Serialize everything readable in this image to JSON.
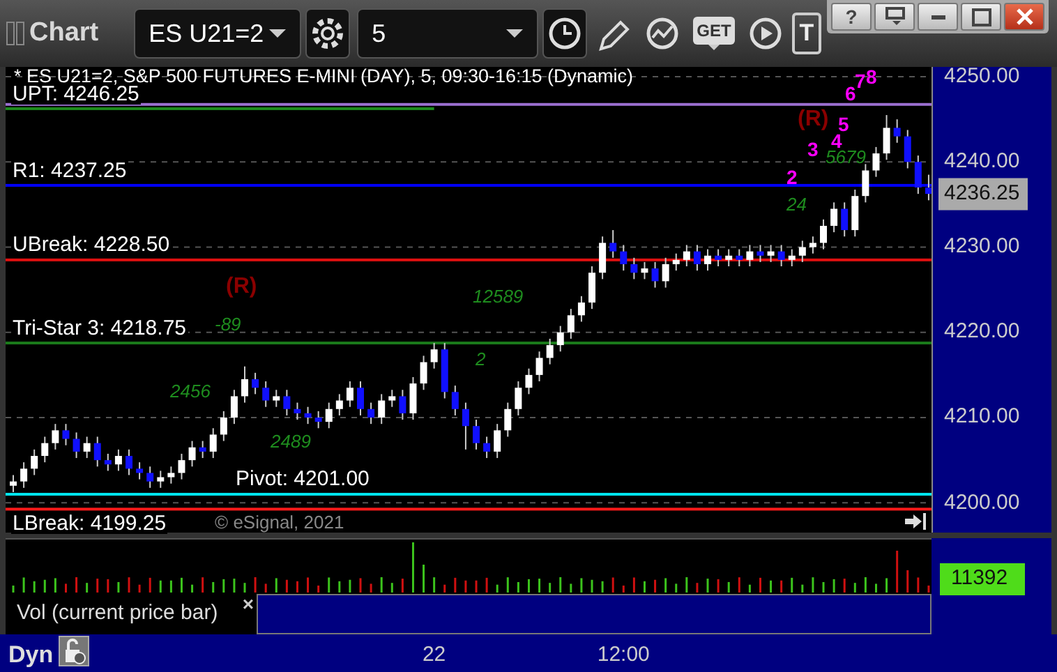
{
  "window": {
    "title": "Chart"
  },
  "toolbar": {
    "symbol": "ES U21=2",
    "interval": "5",
    "tools": [
      {
        "kind": "pencil"
      },
      {
        "kind": "study"
      },
      {
        "kind": "get",
        "label": "GET"
      },
      {
        "kind": "play"
      },
      {
        "kind": "text",
        "label": "T"
      }
    ]
  },
  "window_controls": [
    {
      "kind": "help",
      "label": "?"
    },
    {
      "kind": "dock"
    },
    {
      "kind": "minimize"
    },
    {
      "kind": "maximize"
    },
    {
      "kind": "close"
    }
  ],
  "chart": {
    "title": "* ES U21=2, S&P 500 FUTURES E-MINI (DAY), 5, 09:30-16:15 (Dynamic)",
    "markers": [
      {
        "text": "(R)",
        "color": "#8b0000"
      },
      {
        "text": "-89",
        "color": "#1e8c1e"
      },
      {
        "text": "2456",
        "color": "#1e8c1e"
      },
      {
        "text": "2489",
        "color": "#1e8c1e"
      },
      {
        "text": "12589",
        "color": "#1e8c1e"
      },
      {
        "text": "2",
        "color": "#1e8c1e"
      },
      {
        "text": "24",
        "color": "#1e8c1e"
      },
      {
        "text": "5679",
        "color": "#1e8c1e"
      },
      {
        "text": "(R)",
        "color": "#8b0000"
      },
      {
        "text": "2",
        "color": "#ff00ff"
      },
      {
        "text": "3",
        "color": "#ff00ff"
      },
      {
        "text": "4",
        "color": "#ff00ff"
      },
      {
        "text": "5",
        "color": "#ff00ff"
      },
      {
        "text": "6",
        "color": "#ff00ff"
      },
      {
        "text": "7",
        "color": "#ff00ff"
      },
      {
        "text": "8",
        "color": "#ff00ff"
      }
    ],
    "copyright": "© eSignal, 2021",
    "current_price": "4236.25",
    "chart_data": {
      "type": "candlestick",
      "ylim": [
        4196.5,
        4251.15
      ],
      "grid": true,
      "categories": [
        null,
        null,
        null,
        null,
        null,
        null,
        null,
        null,
        null,
        null,
        null,
        null,
        null,
        null,
        null,
        null,
        null,
        null,
        null,
        null,
        null,
        null,
        null,
        null,
        null,
        null,
        null,
        null,
        null,
        null,
        null,
        null,
        null,
        null,
        null,
        null,
        null,
        null,
        null,
        null,
        "22",
        null,
        null,
        null,
        null,
        null,
        null,
        null,
        null,
        null,
        null,
        null,
        null,
        null,
        null,
        null,
        null,
        null,
        "12:00",
        null,
        null,
        null,
        null,
        null,
        null,
        null,
        null,
        null,
        null,
        null,
        null,
        null,
        null,
        null,
        null,
        null,
        null,
        null,
        null,
        null,
        null,
        null,
        null,
        null,
        null,
        null,
        null,
        null
      ],
      "ref_lines": [
        {
          "axis": "y",
          "value": 4246.25,
          "label": "UPT: 4246.25",
          "color": "#1e8c1e"
        },
        {
          "axis": "y",
          "value": 4246.75,
          "color": "#9b6fd0"
        },
        {
          "axis": "y",
          "value": 4237.25,
          "label": "R1: 4237.25",
          "color": "#0000ff"
        },
        {
          "axis": "y",
          "value": 4228.5,
          "label": "UBreak: 4228.50",
          "color": "#e01010"
        },
        {
          "axis": "y",
          "value": 4218.75,
          "label": "Tri-Star 3: 4218.75",
          "color": "#1a7a1a"
        },
        {
          "axis": "y",
          "value": 4201,
          "label": "Pivot: 4201.00",
          "color": "#00e5ee"
        },
        {
          "axis": "y",
          "value": 4199.25,
          "label": "LBreak: 4199.25",
          "color": "#ff1a1a"
        }
      ],
      "yticks": [
        {
          "value": 4250,
          "label": "4250.00"
        },
        {
          "value": 4240,
          "label": "4240.00"
        },
        {
          "value": 4230,
          "label": "4230.00"
        },
        {
          "value": 4220,
          "label": "4220.00"
        },
        {
          "value": 4210,
          "label": "4210.00"
        },
        {
          "value": 4200,
          "label": "4200.00"
        }
      ],
      "ohlc": [
        [
          4202,
          4203.25,
          4201.25,
          4202.5
        ],
        [
          4202.5,
          4204.75,
          4201.75,
          4204
        ],
        [
          4204,
          4206.25,
          4203.25,
          4205.5
        ],
        [
          4205.5,
          4207.75,
          4204.75,
          4207
        ],
        [
          4207,
          4209.25,
          4206.25,
          4208.5
        ],
        [
          4208.5,
          4209.25,
          4206.75,
          4207.5
        ],
        [
          4207.5,
          4208.25,
          4205.25,
          4206
        ],
        [
          4206,
          4207.75,
          4205.25,
          4207
        ],
        [
          4207,
          4207.75,
          4204.25,
          4205
        ],
        [
          4205,
          4205.75,
          4203.75,
          4204.5
        ],
        [
          4204.5,
          4206.25,
          4203.75,
          4205.5
        ],
        [
          4205.5,
          4206.25,
          4203.25,
          4204
        ],
        [
          4204,
          4204.75,
          4202.75,
          4203.5
        ],
        [
          4203.5,
          4204.25,
          4201.75,
          4202.5
        ],
        [
          4202.5,
          4203.75,
          4201.75,
          4203
        ],
        [
          4203,
          4204.25,
          4202.25,
          4203.5
        ],
        [
          4203.5,
          4205.75,
          4202.75,
          4205
        ],
        [
          4205,
          4207.25,
          4204.25,
          4206.5
        ],
        [
          4206.5,
          4207.25,
          4205.25,
          4206
        ],
        [
          4206,
          4208.75,
          4205.25,
          4208
        ],
        [
          4208,
          4210.75,
          4207.25,
          4210
        ],
        [
          4210,
          4213.25,
          4209.25,
          4212.5
        ],
        [
          4212.5,
          4216,
          4211.75,
          4214.5
        ],
        [
          4214.5,
          4215.25,
          4212.75,
          4213.5
        ],
        [
          4213.5,
          4214.25,
          4211.25,
          4212
        ],
        [
          4212,
          4213.25,
          4211.25,
          4212.5
        ],
        [
          4212.5,
          4213.25,
          4210.25,
          4211
        ],
        [
          4211,
          4211.75,
          4209.75,
          4210.5
        ],
        [
          4210.5,
          4211.25,
          4209.25,
          4210
        ],
        [
          4210,
          4210.75,
          4208.75,
          4209.5
        ],
        [
          4209.5,
          4211.75,
          4208.75,
          4211
        ],
        [
          4211,
          4212.75,
          4210.25,
          4212
        ],
        [
          4212,
          4214.25,
          4211.25,
          4213.5
        ],
        [
          4213.5,
          4214.25,
          4210.25,
          4211
        ],
        [
          4211,
          4211.75,
          4209.25,
          4210
        ],
        [
          4210,
          4212.75,
          4209.25,
          4212
        ],
        [
          4212,
          4213.25,
          4211.25,
          4212.5
        ],
        [
          4212.5,
          4213.25,
          4209.75,
          4210.5
        ],
        [
          4210.5,
          4214.75,
          4209.75,
          4214
        ],
        [
          4214,
          4217.25,
          4213.25,
          4216.5
        ],
        [
          4216.5,
          4218.75,
          4215.75,
          4218
        ],
        [
          4218,
          4218.75,
          4212.25,
          4213
        ],
        [
          4213,
          4213.75,
          4210.25,
          4211
        ],
        [
          4211,
          4211.75,
          4206.25,
          4209
        ],
        [
          4209,
          4209.75,
          4206.25,
          4207
        ],
        [
          4207,
          4207.75,
          4205.25,
          4206
        ],
        [
          4206,
          4209.25,
          4205.25,
          4208.5
        ],
        [
          4208.5,
          4211.75,
          4207.75,
          4211
        ],
        [
          4211,
          4214.25,
          4210.25,
          4213.5
        ],
        [
          4213.5,
          4215.75,
          4212.75,
          4215
        ],
        [
          4215,
          4217.75,
          4214.25,
          4217
        ],
        [
          4217,
          4219.25,
          4216.25,
          4218.5
        ],
        [
          4218.5,
          4220.75,
          4217.75,
          4220
        ],
        [
          4220,
          4222.75,
          4219.25,
          4222
        ],
        [
          4222,
          4224.25,
          4221.25,
          4223.5
        ],
        [
          4223.5,
          4227.75,
          4222.75,
          4227
        ],
        [
          4227,
          4231.25,
          4226.25,
          4230.5
        ],
        [
          4230.5,
          4232,
          4228.75,
          4229.5
        ],
        [
          4229.5,
          4230.25,
          4227.25,
          4228
        ],
        [
          4228,
          4228.75,
          4226.25,
          4227
        ],
        [
          4227,
          4228.25,
          4226.25,
          4227.5
        ],
        [
          4227.5,
          4228.25,
          4225.25,
          4226
        ],
        [
          4226,
          4228.75,
          4225.25,
          4228
        ],
        [
          4228,
          4229.25,
          4227.25,
          4228.5
        ],
        [
          4228.5,
          4230.25,
          4227.75,
          4229.5
        ],
        [
          4229.5,
          4230.25,
          4227.25,
          4228
        ],
        [
          4228,
          4229.75,
          4227.25,
          4229
        ],
        [
          4229,
          4229.75,
          4227.75,
          4228.5
        ],
        [
          4228.5,
          4229.75,
          4227.75,
          4229
        ],
        [
          4229,
          4229.75,
          4227.75,
          4228.5
        ],
        [
          4228.5,
          4230.25,
          4227.75,
          4229.5
        ],
        [
          4229.5,
          4230.25,
          4228.25,
          4229
        ],
        [
          4229,
          4230.25,
          4228.25,
          4229.5
        ],
        [
          4229.5,
          4230.25,
          4227.75,
          4228.5
        ],
        [
          4228.5,
          4229.75,
          4227.75,
          4229
        ],
        [
          4229,
          4230.75,
          4228.25,
          4230
        ],
        [
          4230,
          4231.25,
          4229.25,
          4230.5
        ],
        [
          4230.5,
          4233.25,
          4229.75,
          4232.5
        ],
        [
          4232.5,
          4235.25,
          4231.75,
          4234.5
        ],
        [
          4234.5,
          4235.25,
          4231.25,
          4232
        ],
        [
          4232,
          4236.75,
          4231.25,
          4236
        ],
        [
          4236,
          4239.75,
          4235.25,
          4239
        ],
        [
          4239,
          4241.75,
          4238.25,
          4241
        ],
        [
          4241,
          4245.5,
          4240.25,
          4244
        ],
        [
          4244,
          4245,
          4242.25,
          4243
        ],
        [
          4243,
          4243.75,
          4239.25,
          4240
        ],
        [
          4240,
          4240.75,
          4236.25,
          4237
        ],
        [
          4237,
          4238.5,
          4235.5,
          4236.25
        ]
      ]
    }
  },
  "volume": {
    "current": "11392",
    "tab_label": "Vol (current price bar)",
    "tab_close": "×"
  },
  "x_axis": {
    "mode": "Dyn"
  }
}
